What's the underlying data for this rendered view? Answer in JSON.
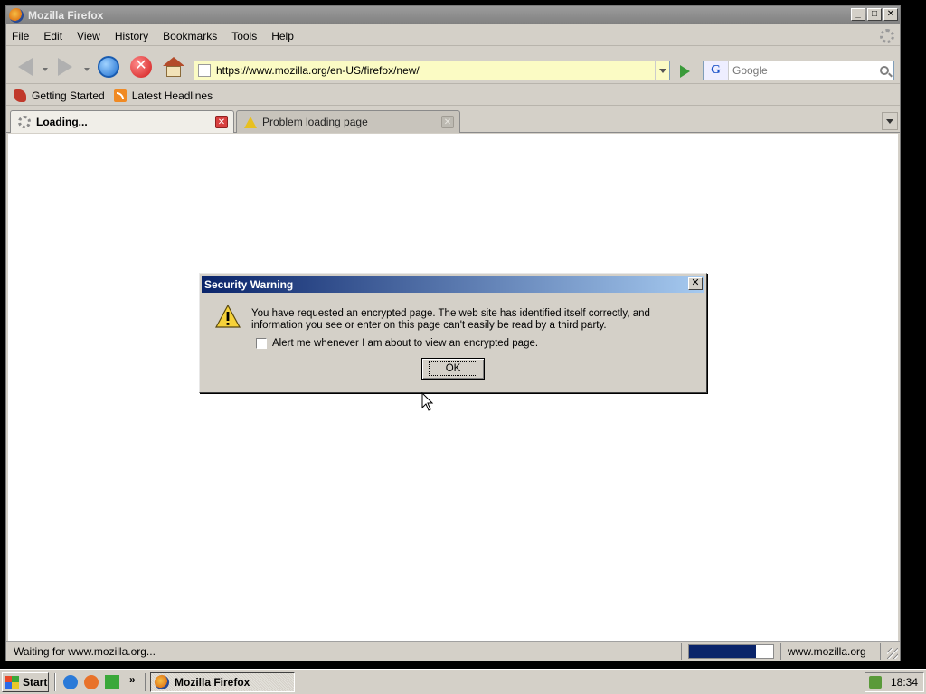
{
  "window": {
    "title": "Mozilla Firefox"
  },
  "menu": [
    "File",
    "Edit",
    "View",
    "History",
    "Bookmarks",
    "Tools",
    "Help"
  ],
  "navbar": {
    "url": "https://www.mozilla.org/en-US/firefox/new/",
    "search_placeholder": "Google"
  },
  "bookmarks": [
    "Getting Started",
    "Latest Headlines"
  ],
  "tabs": [
    {
      "label": "Loading...",
      "active": true
    },
    {
      "label": "Problem loading page",
      "active": false
    }
  ],
  "status": {
    "text": "Waiting for www.mozilla.org...",
    "host": "www.mozilla.org",
    "progress": 0.8
  },
  "dialog": {
    "title": "Security Warning",
    "message": "You have requested an encrypted page. The web site has identified itself correctly, and information you see or enter on this page can't easily be read by a third party.",
    "checkbox_label": "Alert me whenever I am about to view an encrypted page.",
    "checkbox_checked": false,
    "ok_label": "OK"
  },
  "taskbar": {
    "start_label": "Start",
    "more": "»",
    "task_label": "Mozilla Firefox",
    "clock": "18:34"
  },
  "icons": {
    "window": "firefox-icon",
    "bookmark_1": "mozilla-bookmark-icon",
    "bookmark_2": "rss-feed-icon",
    "dialog": "warning-triangle-icon"
  }
}
